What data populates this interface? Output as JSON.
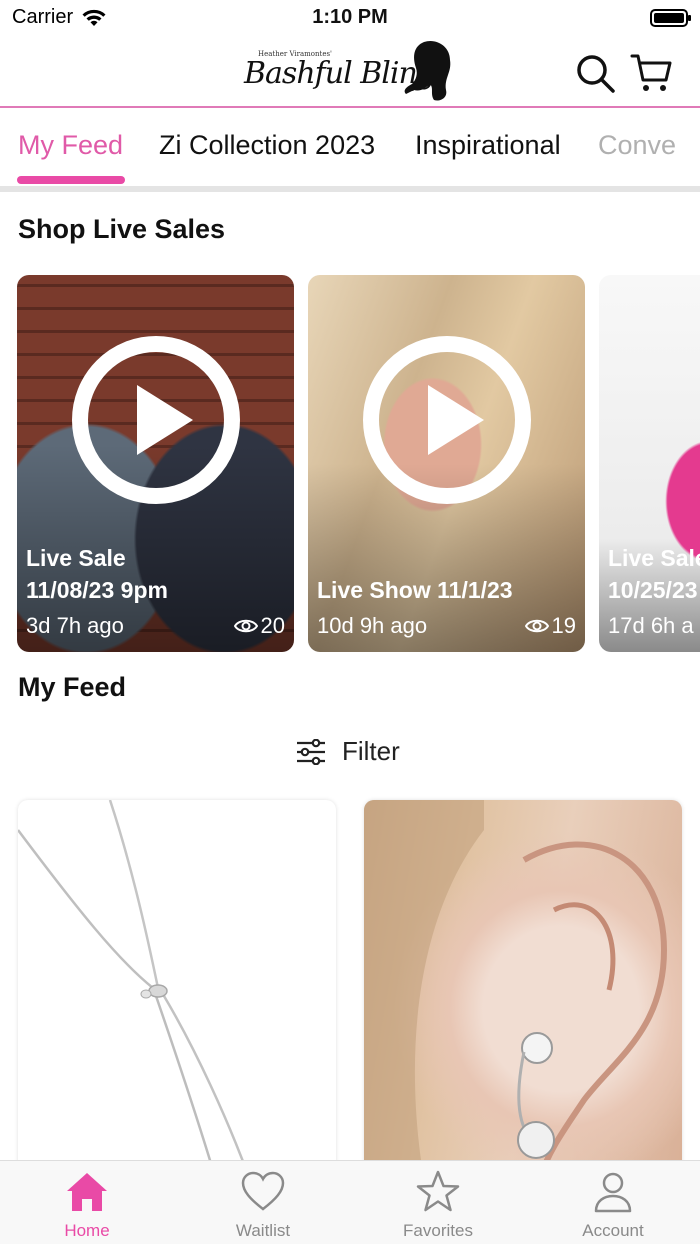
{
  "status": {
    "carrier": "Carrier",
    "time": "1:10 PM"
  },
  "brand": {
    "small_text": "Heather Viramontes'",
    "name": "Bashful Bling"
  },
  "tabs": [
    {
      "label": "My Feed",
      "active": true
    },
    {
      "label": "Zi Collection 2023",
      "active": false
    },
    {
      "label": "Inspirational",
      "active": false
    },
    {
      "label": "Conve",
      "active": false
    }
  ],
  "live": {
    "section_title": "Shop Live Sales",
    "cards": [
      {
        "title_line1": "Live Sale",
        "title_line2": "11/08/23 9pm",
        "age": "3d 7h ago",
        "views": "20"
      },
      {
        "title_line1": "Live Show 11/1/23",
        "age": "10d 9h ago",
        "views": "19"
      },
      {
        "title_line1": "Live Sale",
        "title_line2": "10/25/23",
        "age": "17d 6h a"
      }
    ]
  },
  "feed": {
    "section_title": "My Feed",
    "filter_label": "Filter"
  },
  "nav": {
    "items": [
      {
        "label": "Home",
        "icon": "home-icon",
        "active": true
      },
      {
        "label": "Waitlist",
        "icon": "heart-icon",
        "active": false
      },
      {
        "label": "Favorites",
        "icon": "star-icon",
        "active": false
      },
      {
        "label": "Account",
        "icon": "person-icon",
        "active": false
      }
    ]
  },
  "colors": {
    "accent": "#e94aa6",
    "header_border": "#e07ab8",
    "inactive": "#8a8a8a"
  }
}
